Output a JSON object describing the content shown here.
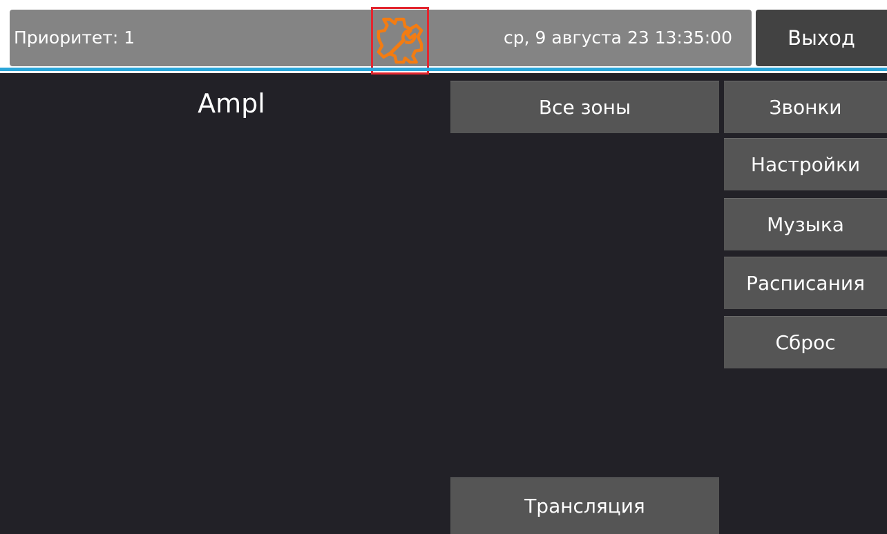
{
  "header": {
    "priority_text": "Приоритет: 1",
    "datetime_text": "ср, 9 августа 23 13:35:00",
    "settings_icon": "gear-wrench-icon",
    "exit_label": "Выход"
  },
  "main": {
    "device_name": "Ampl",
    "all_zones_label": "Все зоны",
    "translation_label": "Трансляция"
  },
  "side_menu": {
    "calls_label": "Звонки",
    "settings_label": "Настройки",
    "music_label": "Музыка",
    "schedules_label": "Расписания",
    "reset_label": "Сброс"
  },
  "colors": {
    "background": "#222127",
    "status_panel": "#848484",
    "button": "#555555",
    "accent": "#2ba6d9",
    "icon": "#f37c12",
    "highlight_border": "#e3262f"
  }
}
